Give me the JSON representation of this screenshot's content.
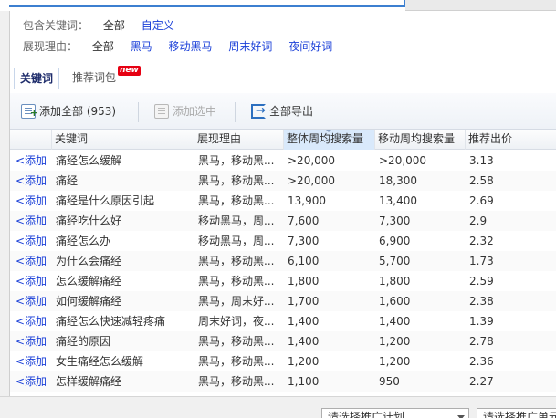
{
  "filters": {
    "include_keyword": {
      "label": "包含关键词：",
      "options": [
        "全部",
        "自定义"
      ]
    },
    "reason": {
      "label": "展现理由：",
      "options": [
        "全部",
        "黑马",
        "移动黑马",
        "周末好词",
        "夜间好词"
      ]
    }
  },
  "tabs": {
    "items": [
      "关键词",
      "推荐词包"
    ],
    "active": "关键词",
    "badge": "new"
  },
  "toolbar": {
    "add_all": "添加全部 (953)",
    "add_selected": "添加选中",
    "export_all": "全部导出"
  },
  "table": {
    "columns": [
      "关键词",
      "展现理由",
      "整体周均搜索量",
      "移动周均搜索量",
      "推荐出价"
    ],
    "add_label": "<添加",
    "rows": [
      [
        "痛经怎么缓解",
        "黑马，移动黑...",
        ">20,000",
        ">20,000",
        "3.13"
      ],
      [
        "痛经",
        "黑马，移动黑...",
        ">20,000",
        "18,300",
        "2.58"
      ],
      [
        "痛经是什么原因引起",
        "黑马，移动黑...",
        "13,900",
        "13,400",
        "2.69"
      ],
      [
        "痛经吃什么好",
        "移动黑马，周...",
        "7,600",
        "7,300",
        "2.9"
      ],
      [
        "痛经怎么办",
        "移动黑马，周...",
        "7,300",
        "6,900",
        "2.32"
      ],
      [
        "为什么会痛经",
        "黑马，移动黑...",
        "6,100",
        "5,700",
        "1.73"
      ],
      [
        "怎么缓解痛经",
        "黑马，移动黑...",
        "1,800",
        "1,800",
        "2.59"
      ],
      [
        "如何缓解痛经",
        "黑马，周末好...",
        "1,700",
        "1,600",
        "2.38"
      ],
      [
        "痛经怎么快速减轻疼痛",
        "周末好词，夜...",
        "1,400",
        "1,400",
        "1.39"
      ],
      [
        "痛经的原因",
        "黑马，移动黑...",
        "1,400",
        "1,200",
        "2.78"
      ],
      [
        "女生痛经怎么缓解",
        "黑马，移动黑...",
        "1,200",
        "1,200",
        "2.36"
      ],
      [
        "怎样缓解痛经",
        "黑马，移动黑...",
        "1,100",
        "950",
        "2.27"
      ]
    ]
  },
  "bottom": {
    "select_plan": "请选择推广计划",
    "select_unit": "请选择推广单元"
  },
  "colors": {
    "link": "#1a3fd8",
    "badge": "#e60012",
    "accent": "#2c6fc0"
  }
}
